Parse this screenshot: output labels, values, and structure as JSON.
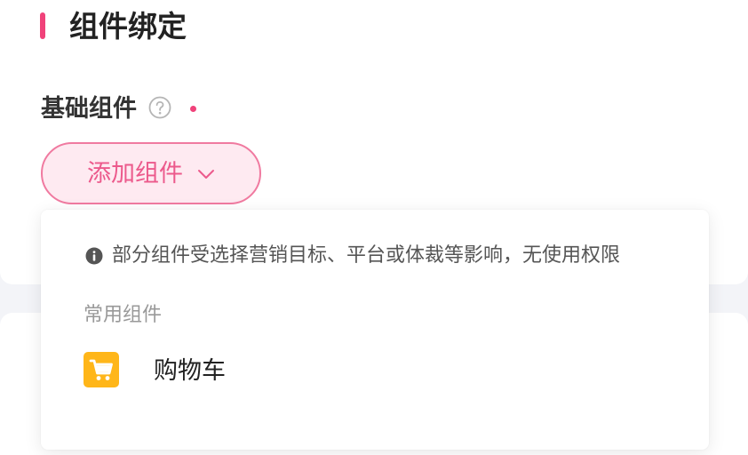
{
  "section": {
    "title": "组件绑定"
  },
  "field": {
    "label": "基础组件"
  },
  "add_button": {
    "label": "添加组件"
  },
  "dropdown": {
    "notice": "部分组件受选择营销目标、平台或体裁等影响，无使用权限",
    "groups": [
      {
        "label": "常用组件",
        "items": [
          {
            "label": "购物车",
            "icon": "shopping-cart-icon"
          }
        ]
      }
    ]
  },
  "icons": {
    "help": "help-circle-icon",
    "info": "info-circle-icon",
    "chevron": "chevron-down-icon"
  },
  "colors": {
    "accent": "#f0427a",
    "accent_light": "#feeaf1",
    "accent_text": "#ec5a8c",
    "cart_icon_bg": "#ffb619"
  }
}
